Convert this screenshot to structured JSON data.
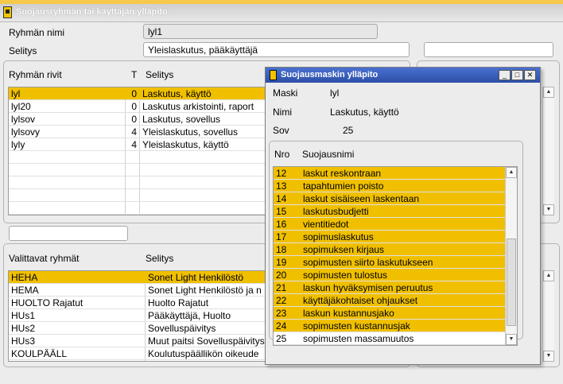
{
  "window": {
    "title": "Suojausryhmän tai käyttäjän ylläpito"
  },
  "form": {
    "ryhman_nimi_label": "Ryhmän nimi",
    "ryhman_nimi_value": "lyl1",
    "selitys_label": "Selitys",
    "selitys_value": "Yleislaskutus, pääkäyttäjä"
  },
  "rows_table": {
    "headers": [
      "Ryhmän rivit",
      "T",
      "Selitys"
    ],
    "rows": [
      {
        "name": "lyl",
        "t": "0",
        "desc": "Laskutus, käyttö"
      },
      {
        "name": "lyl20",
        "t": "0",
        "desc": "Laskutus arkistointi, raport"
      },
      {
        "name": "lylsov",
        "t": "0",
        "desc": "Laskutus, sovellus"
      },
      {
        "name": "lylsovy",
        "t": "4",
        "desc": "Yleislaskutus, sovellus"
      },
      {
        "name": "lyly",
        "t": "4",
        "desc": "Yleislaskutus, käyttö"
      }
    ]
  },
  "groups_table": {
    "headers": [
      "Valittavat ryhmät",
      "Selitys"
    ],
    "rows": [
      {
        "name": "HEHA",
        "desc": "Sonet Light Henkilöstö"
      },
      {
        "name": "HEMA",
        "desc": "Sonet Light Henkilöstö ja n"
      },
      {
        "name": "HUOLTO Rajatut",
        "desc": "Huolto Rajatut"
      },
      {
        "name": "HUs1",
        "desc": "Pääkäyttäjä, Huolto"
      },
      {
        "name": "HUs2",
        "desc": "Sovelluspäivitys"
      },
      {
        "name": "HUs3",
        "desc": "Muut paitsi Sovelluspäivitys"
      },
      {
        "name": "KOULPÄÄLL",
        "desc": "Koulutuspäällikön oikeude"
      }
    ]
  },
  "dialog": {
    "title": "Suojausmaskin ylläpito",
    "maski_label": "Maski",
    "maski_value": "lyl",
    "nimi_label": "Nimi",
    "nimi_value": "Laskutus, käyttö",
    "sov_label": "Sov",
    "sov_value": "25",
    "headers": [
      "Nro",
      "Suojausnimi"
    ],
    "rows": [
      {
        "nro": "12",
        "name": "laskut reskontraan",
        "selected": true
      },
      {
        "nro": "13",
        "name": "tapahtumien poisto",
        "selected": true
      },
      {
        "nro": "14",
        "name": "laskut sisäiseen laskentaan",
        "selected": true
      },
      {
        "nro": "15",
        "name": "laskutusbudjetti",
        "selected": true
      },
      {
        "nro": "16",
        "name": "vientitiedot",
        "selected": true
      },
      {
        "nro": "17",
        "name": "sopimuslaskutus",
        "selected": true
      },
      {
        "nro": "18",
        "name": "sopimuksen kirjaus",
        "selected": true
      },
      {
        "nro": "19",
        "name": "sopimusten siirto laskutukseen",
        "selected": true
      },
      {
        "nro": "20",
        "name": "sopimusten tulostus",
        "selected": true
      },
      {
        "nro": "21",
        "name": "laskun hyväksymisen peruutus",
        "selected": true
      },
      {
        "nro": "22",
        "name": "käyttäjäkohtaiset ohjaukset",
        "selected": true
      },
      {
        "nro": "23",
        "name": "laskun kustannusjako",
        "selected": true
      },
      {
        "nro": "24",
        "name": "sopimusten kustannusjak",
        "selected": true
      },
      {
        "nro": "25",
        "name": "sopimusten massamuutos",
        "selected": false
      }
    ]
  },
  "colors": {
    "selection": "#f0c000",
    "dialog_title": "#2c4ea6",
    "accent": "#f7c94b"
  }
}
